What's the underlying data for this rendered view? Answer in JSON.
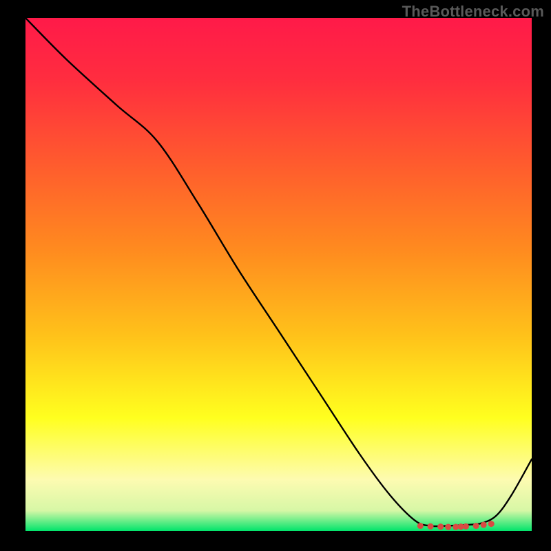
{
  "watermark": "TheBottleneck.com",
  "chart_data": {
    "type": "line",
    "title": "",
    "xlabel": "",
    "ylabel": "",
    "xlim": [
      0,
      100
    ],
    "ylim": [
      0,
      100
    ],
    "grid": false,
    "legend": false,
    "gradient_stops": [
      {
        "offset": 0.0,
        "color": "#ff1a49"
      },
      {
        "offset": 0.12,
        "color": "#ff2d3f"
      },
      {
        "offset": 0.28,
        "color": "#ff5a2e"
      },
      {
        "offset": 0.45,
        "color": "#ff8a1f"
      },
      {
        "offset": 0.62,
        "color": "#ffc21a"
      },
      {
        "offset": 0.78,
        "color": "#ffff1f"
      },
      {
        "offset": 0.9,
        "color": "#fdfbb1"
      },
      {
        "offset": 0.96,
        "color": "#d7f7a6"
      },
      {
        "offset": 1.0,
        "color": "#00e46b"
      }
    ],
    "series": [
      {
        "name": "curve",
        "x": [
          0,
          8,
          18,
          26,
          34,
          42,
          50,
          58,
          66,
          72,
          77,
          80,
          83,
          87,
          90,
          93,
          96,
          100
        ],
        "y": [
          100,
          92,
          83,
          76,
          64,
          51,
          39,
          27,
          15,
          7,
          2,
          1,
          1,
          1.2,
          1.5,
          3,
          7,
          14
        ]
      }
    ],
    "markers": {
      "name": "sweet-spot",
      "x": [
        78,
        80,
        82,
        83.5,
        85,
        86,
        87,
        89,
        90.5,
        92
      ],
      "y": [
        1.0,
        0.9,
        0.85,
        0.8,
        0.8,
        0.85,
        0.9,
        1.0,
        1.2,
        1.4
      ],
      "color": "#d94b43",
      "radius": 4.5
    }
  }
}
